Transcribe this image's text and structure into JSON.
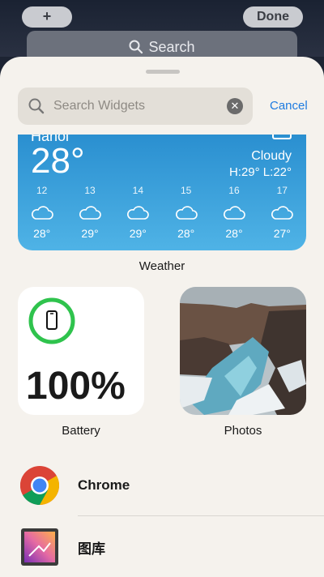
{
  "topbar": {
    "plus_label": "+",
    "done_label": "Done",
    "search_label": "Search"
  },
  "widgets_panel": {
    "search_placeholder": "Search Widgets",
    "cancel_label": "Cancel",
    "clear_glyph": "✕"
  },
  "weather": {
    "city": "Hanoi",
    "temperature": "28°",
    "condition": "Cloudy",
    "hi_lo": "H:29° L:22°",
    "hours": [
      {
        "hour": "12",
        "temp": "28°"
      },
      {
        "hour": "13",
        "temp": "29°"
      },
      {
        "hour": "14",
        "temp": "29°"
      },
      {
        "hour": "15",
        "temp": "28°"
      },
      {
        "hour": "16",
        "temp": "28°"
      },
      {
        "hour": "17",
        "temp": "27°"
      }
    ],
    "caption": "Weather"
  },
  "battery": {
    "value": "100%",
    "caption": "Battery"
  },
  "photos": {
    "caption": "Photos"
  },
  "apps": [
    {
      "name": "Chrome",
      "icon": "chrome-icon"
    },
    {
      "name": "图库",
      "icon": "gallery-icon"
    }
  ]
}
